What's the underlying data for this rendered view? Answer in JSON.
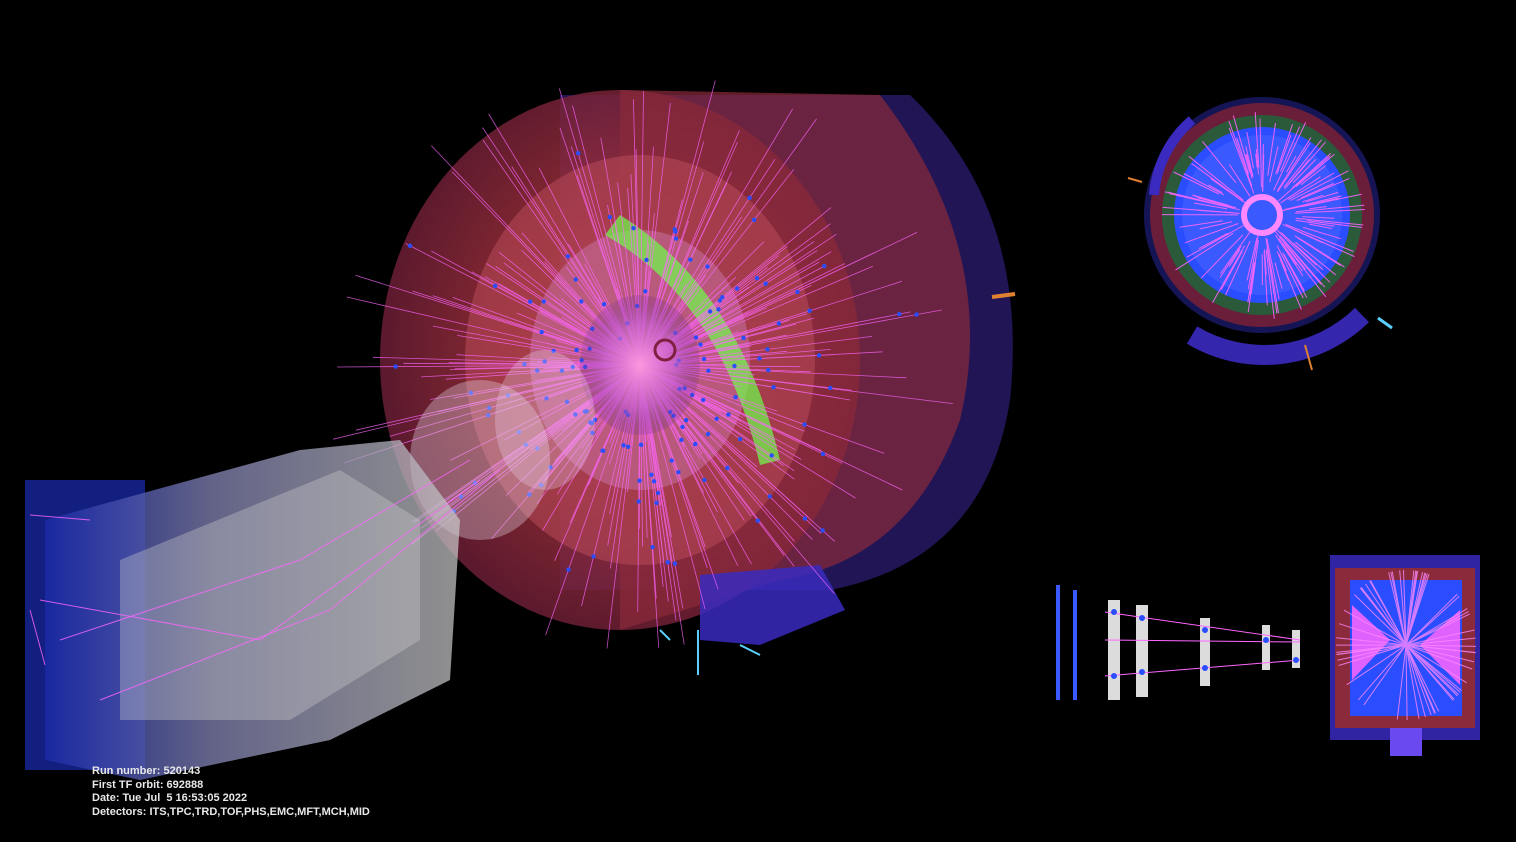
{
  "event_info": {
    "run_number": "Run number: 520143",
    "first_tf_orbit": "First TF orbit: 692888",
    "date": "Date: Tue Jul  5 16:53:05 2022",
    "detectors": "Detectors: ITS,TPC,TRD,TOF,PHS,EMC,MFT,MCH,MID"
  },
  "colors": {
    "background": "#000000",
    "detector_red": "#b02a2a",
    "track_magenta": "#ff66ff",
    "hit_blue": "#2a4dff",
    "calorimeter_green": "#6cff4a",
    "muon_grey": "#b8b8b8",
    "muon_blue": "#1a2aa8"
  },
  "views": {
    "main_3d": "3d-event-view",
    "rphi": "rphi-projection-view",
    "rhoz": "rhoz-projection-view"
  }
}
